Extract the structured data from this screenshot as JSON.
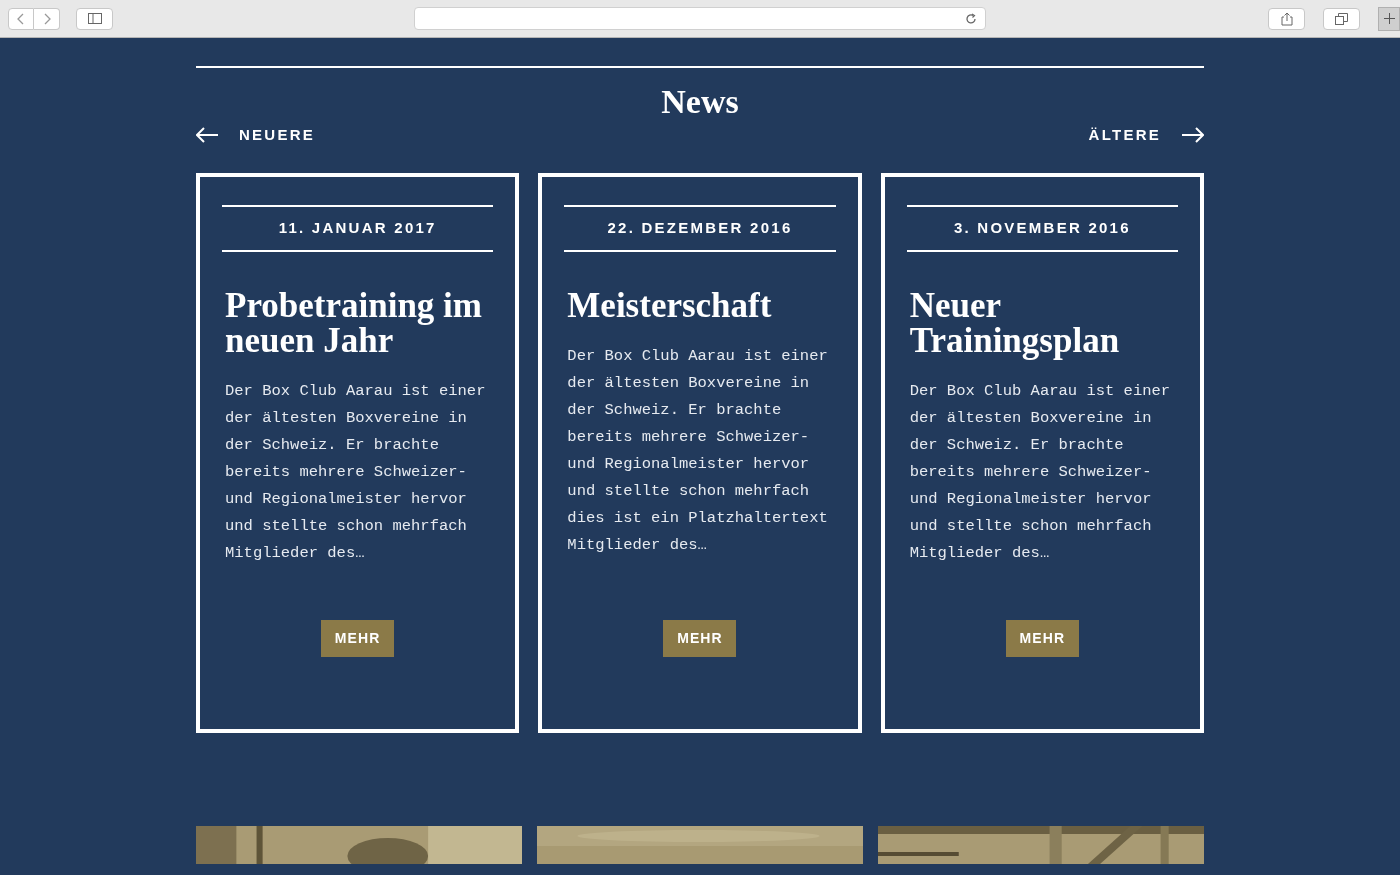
{
  "section": {
    "title": "News",
    "nav": {
      "newer": "NEUERE",
      "older": "ÄLTERE"
    }
  },
  "cards": [
    {
      "date": "11. JANUAR 2017",
      "title": "Probetraining im neuen Jahr",
      "text": "Der Box Club Aarau ist einer der ältesten Boxvereine in der Schweiz. Er brachte bereits mehrere Schweizer- und Regionalmeister hervor und stellte schon mehrfach Mitglieder des…",
      "button": "MEHR"
    },
    {
      "date": "22. DEZEMBER 2016",
      "title": "Meisterschaft",
      "text": "Der Box Club Aarau ist einer der ältesten Boxvereine in der Schweiz. Er brachte bereits mehrere Schweizer- und Regionalmeister hervor und stellte schon mehrfach dies ist ein Platzhaltertext Mitglieder des…",
      "button": "MEHR"
    },
    {
      "date": "3. NOVEMBER 2016",
      "title": "Neuer Trainingsplan",
      "text": "Der Box Club Aarau ist einer der ältesten Boxvereine in der Schweiz. Er brachte bereits mehrere Schweizer- und Regionalmeister hervor und stellte schon mehrfach Mitglieder des…",
      "button": "MEHR"
    }
  ]
}
